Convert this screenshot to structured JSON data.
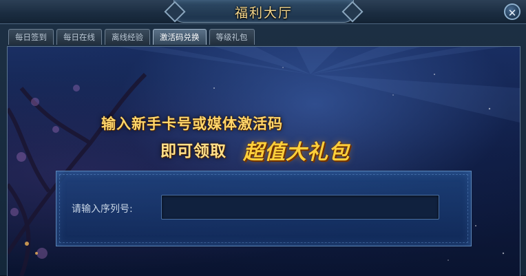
{
  "window": {
    "title": "福利大厅",
    "close_label": "✕"
  },
  "tabs": [
    {
      "label": "每日签到",
      "active": false
    },
    {
      "label": "每日在线",
      "active": false
    },
    {
      "label": "离线经验",
      "active": false
    },
    {
      "label": "激活码兑换",
      "active": true
    },
    {
      "label": "等级礼包",
      "active": false
    }
  ],
  "promo": {
    "line1": "输入新手卡号或媒体激活码",
    "line2": "即可领取",
    "highlight": "超值大礼包"
  },
  "serial": {
    "label": "请输入序列号:",
    "value": "",
    "placeholder": ""
  },
  "colors": {
    "title_gold": "#f3d58a",
    "promo_gold": "#ffd66a",
    "panel_blue": "#1e4682"
  }
}
